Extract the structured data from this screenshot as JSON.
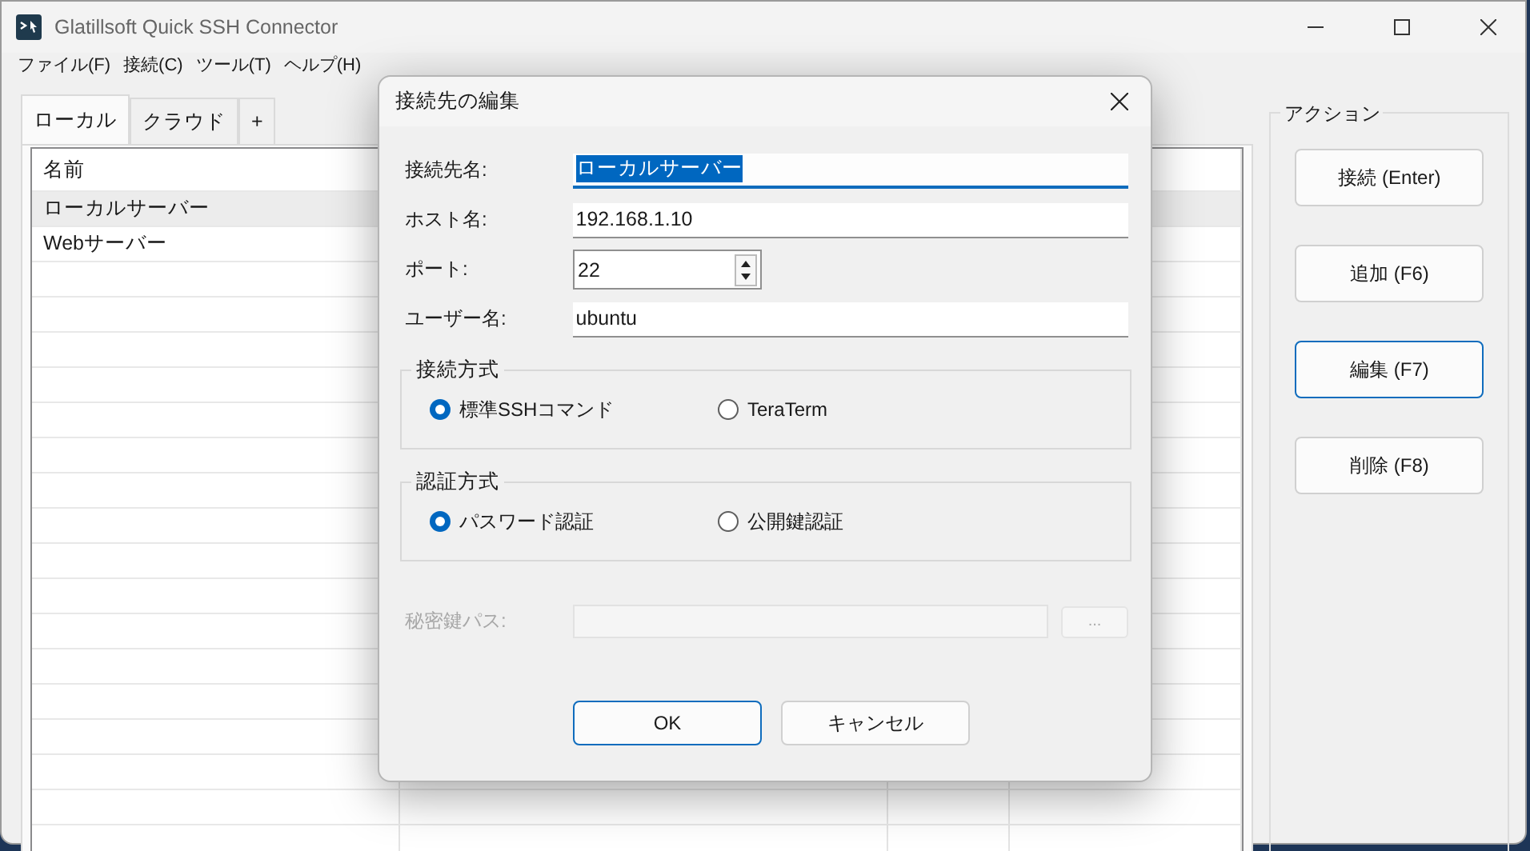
{
  "window": {
    "title": "Glatillsoft Quick SSH Connector"
  },
  "menu": [
    "ファイル(F)",
    "接続(C)",
    "ツール(T)",
    "ヘルプ(H)"
  ],
  "tabs": [
    {
      "label": "ローカル",
      "selected": true
    },
    {
      "label": "クラウド",
      "selected": false
    },
    {
      "label": "+",
      "selected": false
    }
  ],
  "list": {
    "header": "名前",
    "rows": [
      {
        "name": "ローカルサーバー",
        "selected": true
      },
      {
        "name": "Webサーバー",
        "selected": false
      }
    ]
  },
  "actions": {
    "title": "アクション",
    "buttons": [
      {
        "label": "接続 (Enter)",
        "focused": false
      },
      {
        "label": "追加 (F6)",
        "focused": false
      },
      {
        "label": "編集 (F7)",
        "focused": true
      },
      {
        "label": "削除 (F8)",
        "focused": false
      }
    ]
  },
  "dialog": {
    "title": "接続先の編集",
    "fields": [
      {
        "label": "接続先名:",
        "value": "ローカルサーバー",
        "kind": "text",
        "focused": true
      },
      {
        "label": "ホスト名:",
        "value": "192.168.1.10",
        "kind": "text",
        "focused": false
      },
      {
        "label": "ポート:",
        "value": "22",
        "kind": "spin",
        "focused": false
      },
      {
        "label": "ユーザー名:",
        "value": "ubuntu",
        "kind": "text",
        "focused": false
      }
    ],
    "groups": [
      {
        "title": "接続方式",
        "options": [
          {
            "label": "標準SSHコマンド",
            "selected": true
          },
          {
            "label": "TeraTerm",
            "selected": false
          }
        ]
      },
      {
        "title": "認証方式",
        "options": [
          {
            "label": "パスワード認証",
            "selected": true
          },
          {
            "label": "公開鍵認証",
            "selected": false
          }
        ]
      }
    ],
    "key_path": {
      "label": "秘密鍵パス:",
      "disabled": true,
      "browse": "..."
    },
    "buttons": [
      {
        "label": "OK",
        "default": true
      },
      {
        "label": "キャンセル",
        "default": false
      }
    ]
  }
}
